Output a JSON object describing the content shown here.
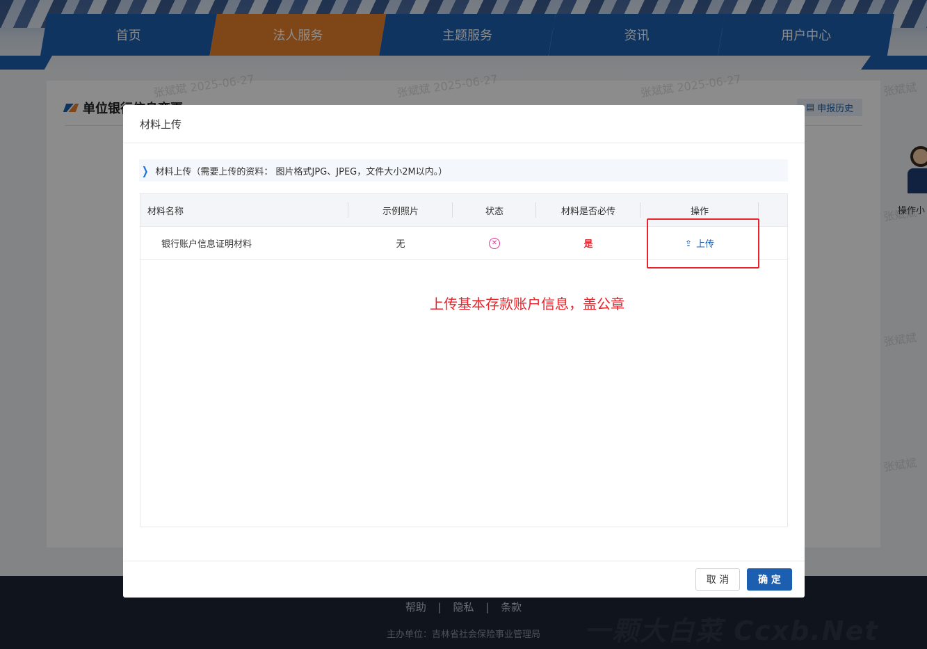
{
  "nav": {
    "items": [
      "首页",
      "法人服务",
      "主题服务",
      "资讯",
      "用户中心"
    ],
    "active_index": 1
  },
  "page": {
    "title": "单位银行信息变更",
    "history_button": "申报历史"
  },
  "helper": {
    "label": "操作小"
  },
  "watermark": {
    "user": "张斌斌",
    "date": "2025-06-27"
  },
  "footer": {
    "links": [
      "帮助",
      "隐私",
      "条款"
    ],
    "separator": "|",
    "organizer": "主办单位：吉林省社会保险事业管理局",
    "brand": "一颗大白菜 Ccxb.Net"
  },
  "modal": {
    "title": "材料上传",
    "notice": "材料上传（需要上传的资料： 图片格式JPG、JPEG，文件大小2M以内。）",
    "columns": [
      "材料名称",
      "示例照片",
      "状态",
      "材料是否必传",
      "操作"
    ],
    "rows": [
      {
        "name": "银行账户信息证明材料",
        "sample": "无",
        "status_icon": "circle-x-icon",
        "required": "是",
        "action": "上传"
      }
    ],
    "annotation": "上传基本存款账户信息，盖公章",
    "cancel_label": "取 消",
    "ok_label": "确 定"
  },
  "colors": {
    "brand_blue": "#1c5fb0",
    "nav_active": "#e8822a",
    "annotation_red": "#e8232a",
    "status_pink": "#e0358f"
  }
}
